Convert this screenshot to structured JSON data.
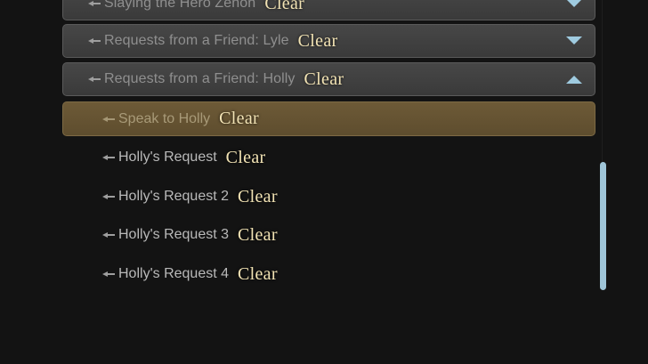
{
  "quests": [
    {
      "title": "Slaying the Hero Zenon",
      "status": "Clear",
      "expanded": false
    },
    {
      "title": "Requests from a Friend: Lyle",
      "status": "Clear",
      "expanded": false
    },
    {
      "title": "Requests from a Friend: Holly",
      "status": "Clear",
      "expanded": true
    }
  ],
  "subquests": [
    {
      "title": "Speak to Holly",
      "status": "Clear",
      "selected": true
    },
    {
      "title": "Holly's Request",
      "status": "Clear"
    },
    {
      "title": "Holly's Request 2",
      "status": "Clear"
    },
    {
      "title": "Holly's Request 3",
      "status": "Clear"
    },
    {
      "title": "Holly's Request 4",
      "status": "Clear"
    }
  ],
  "colors": {
    "background": "#131313",
    "header": "#424242",
    "selected": "#6a5735",
    "clear_text": "#f2e3b4",
    "chevron": "#9fcbe0",
    "scrollbar": "#9fc5d8"
  }
}
